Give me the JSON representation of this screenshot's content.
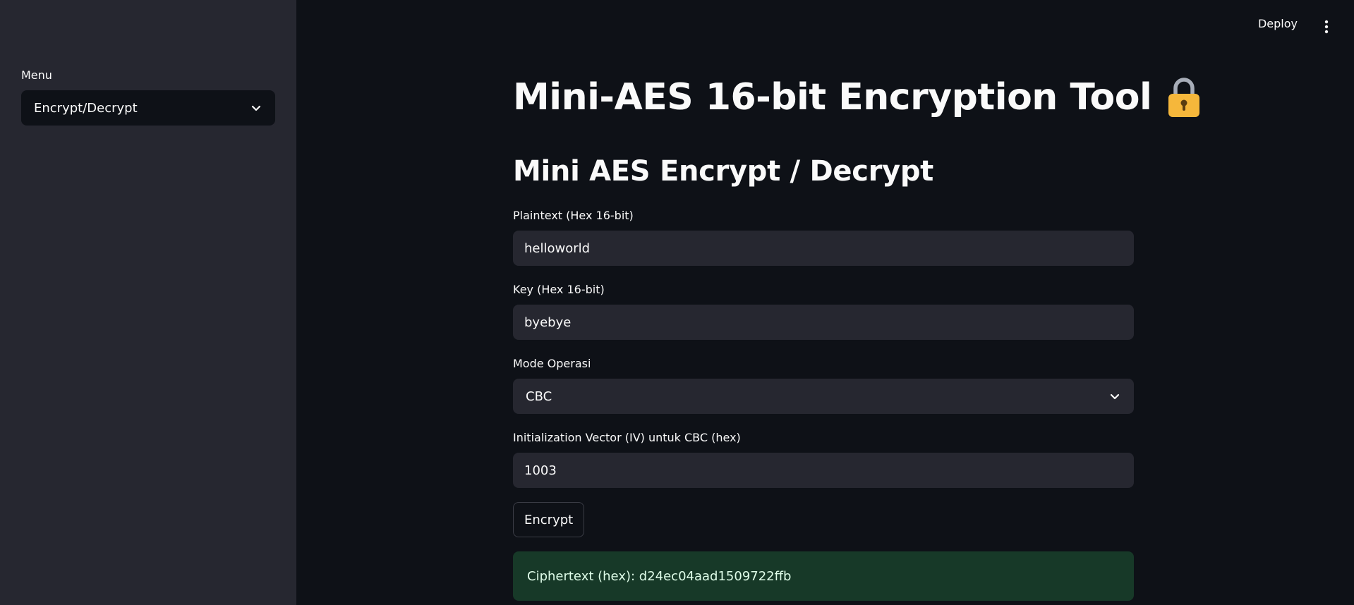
{
  "sidebar": {
    "menu_label": "Menu",
    "menu_selected": "Encrypt/Decrypt"
  },
  "header": {
    "deploy_label": "Deploy"
  },
  "main": {
    "title": "Mini-AES 16-bit Encryption Tool",
    "title_icon": "lock-icon",
    "subheader": "Mini AES Encrypt / Decrypt",
    "plaintext": {
      "label": "Plaintext (Hex 16-bit)",
      "value": "helloworld"
    },
    "key": {
      "label": "Key (Hex 16-bit)",
      "value": "byebye"
    },
    "mode": {
      "label": "Mode Operasi",
      "selected": "CBC"
    },
    "iv": {
      "label": "Initialization Vector (IV) untuk CBC (hex)",
      "value": "1003"
    },
    "encrypt_label": "Encrypt",
    "result": "Ciphertext (hex): d24ec04aad1509722ffb"
  },
  "colors": {
    "background": "#0e1117",
    "sidebar": "#262730",
    "input": "#262730",
    "success_bg": "#173928",
    "success_text": "#dffde9",
    "lock_body": "#f5b73b"
  }
}
